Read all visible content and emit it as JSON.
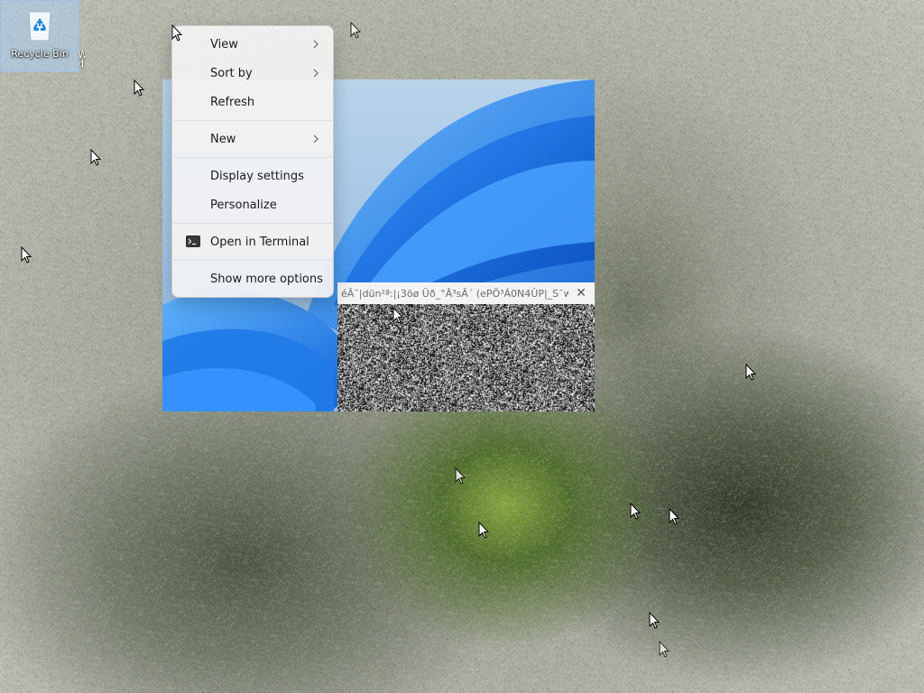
{
  "desktop": {
    "icons": [
      {
        "label": "Recycle Bin",
        "icon": "recycle-bin-icon"
      }
    ],
    "partial_icon_label": "W d"
  },
  "preview_window": {
    "title": "éÂ¯|dün²ª:|¡3öø Üð_°Â³sÂ´ (ePÖ³Á0N4ÛP|_S¯w",
    "close_symbol": "✕"
  },
  "context_menu": {
    "items": [
      {
        "label": "View",
        "has_submenu": true
      },
      {
        "label": "Sort by",
        "has_submenu": true
      },
      {
        "label": "Refresh",
        "has_submenu": false
      },
      {
        "label": "New",
        "has_submenu": true
      },
      {
        "label": "Display settings",
        "has_submenu": false
      },
      {
        "label": "Personalize",
        "has_submenu": false
      },
      {
        "label": "Open in Terminal",
        "has_submenu": false,
        "icon": "terminal-icon"
      },
      {
        "label": "Show more options",
        "has_submenu": false
      }
    ]
  },
  "colors": {
    "menu_bg": "#f3f3f3",
    "wallpaper_blue": "#1e7bf0",
    "selection_blue": "#aacdf0"
  }
}
